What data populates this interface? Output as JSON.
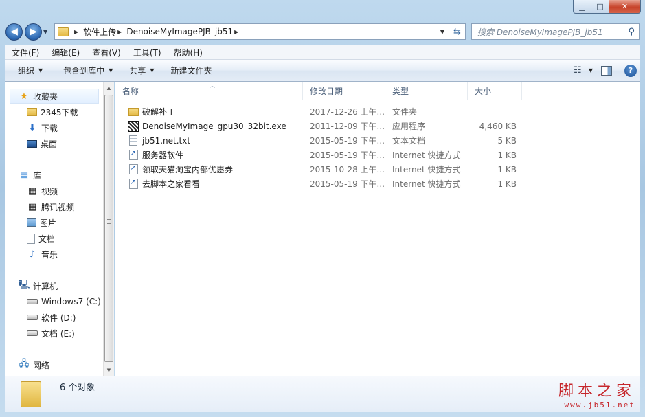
{
  "window": {
    "minimize_glyph": "▁",
    "maximize_glyph": "□",
    "close_glyph": "✕"
  },
  "nav": {
    "back_glyph": "◀",
    "forward_glyph": "▶"
  },
  "address": {
    "breadcrumb": [
      "软件上传",
      "DenoiseMyImagePJB_jb51"
    ],
    "search_placeholder": "搜索 DenoiseMyImagePJB_jb51"
  },
  "menu": [
    "文件(F)",
    "编辑(E)",
    "查看(V)",
    "工具(T)",
    "帮助(H)"
  ],
  "commands": {
    "organize": "组织",
    "include_in_library": "包含到库中",
    "share": "共享",
    "new_folder": "新建文件夹"
  },
  "sidebar": {
    "favorites": {
      "label": "收藏夹",
      "items": [
        "2345下载",
        "下载",
        "桌面"
      ]
    },
    "libraries": {
      "label": "库",
      "items": [
        "视频",
        "腾讯视频",
        "图片",
        "文档",
        "音乐"
      ]
    },
    "computer": {
      "label": "计算机",
      "items": [
        "Windows7 (C:)",
        "软件 (D:)",
        "文档 (E:)"
      ]
    },
    "network": {
      "label": "网络"
    }
  },
  "columns": {
    "name": "名称",
    "date": "修改日期",
    "type": "类型",
    "size": "大小"
  },
  "files": [
    {
      "name": "破解补丁",
      "date": "2017-12-26 上午...",
      "type": "文件夹",
      "size": "",
      "icon": "folder-icon"
    },
    {
      "name": "DenoiseMyImage_gpu30_32bit.exe",
      "date": "2011-12-09 下午...",
      "type": "应用程序",
      "size": "4,460 KB",
      "icon": "exe-icon"
    },
    {
      "name": "jb51.net.txt",
      "date": "2015-05-19 下午...",
      "type": "文本文档",
      "size": "5 KB",
      "icon": "text-file-icon"
    },
    {
      "name": "服务器软件",
      "date": "2015-05-19 下午...",
      "type": "Internet 快捷方式",
      "size": "1 KB",
      "icon": "shortcut-icon"
    },
    {
      "name": "领取天猫淘宝内部优惠券",
      "date": "2015-10-28 上午...",
      "type": "Internet 快捷方式",
      "size": "1 KB",
      "icon": "shortcut-icon"
    },
    {
      "name": "去脚本之家看看",
      "date": "2015-05-19 下午...",
      "type": "Internet 快捷方式",
      "size": "1 KB",
      "icon": "shortcut-icon"
    }
  ],
  "details": {
    "count": "6 个对象"
  },
  "watermark": {
    "cn": "脚本之家",
    "url": "www.jb51.net"
  },
  "colors": {
    "accent": "#2a66b0",
    "watermark": "#c6262b",
    "close": "#c7432a"
  }
}
